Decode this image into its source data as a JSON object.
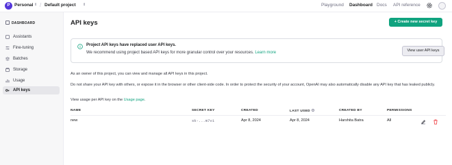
{
  "topbar": {
    "org_initial": "P",
    "org_name": "Personal",
    "project_name": "Default project",
    "nav": [
      "Playground",
      "Dashboard",
      "Docs",
      "API reference"
    ],
    "active_nav": "Dashboard"
  },
  "sidebar": {
    "heading": "DASHBOARD",
    "items": [
      {
        "label": "Assistants",
        "icon": "assistants-icon"
      },
      {
        "label": "Fine-tuning",
        "icon": "fine-tuning-icon"
      },
      {
        "label": "Batches",
        "icon": "batches-icon"
      },
      {
        "label": "Storage",
        "icon": "storage-icon"
      },
      {
        "label": "Usage",
        "icon": "usage-icon"
      },
      {
        "label": "API keys",
        "icon": "key-icon",
        "active": true
      }
    ]
  },
  "main": {
    "title": "API keys",
    "create_button": "+ Create new secret key",
    "notice": {
      "title": "Project API keys have replaced user API keys.",
      "text": "We recommend using project based API keys for more granular control over your resources.",
      "link": "Learn more",
      "button": "View user API keys"
    },
    "para1": "As an owner of this project, you can view and manage all API keys in this project.",
    "para2": "Do not share your API key with others, or expose it in the browser or other client-side code. In order to protect the security of your account, OpenAI may also automatically disable any API key that has leaked publicly.",
    "para3_text": "View usage per API key on the",
    "para3_link": "Usage page",
    "para3_end": "."
  },
  "table": {
    "columns": [
      "NAME",
      "SECRET KEY",
      "CREATED",
      "LAST USED",
      "CREATED BY",
      "PERMISSIONS"
    ],
    "rows": [
      {
        "name": "new",
        "secret_key": "sk-...m7vi",
        "created": "Apr 8, 2024",
        "last_used": "Apr 8, 2024",
        "created_by": "Harshita Batra",
        "permissions": "All"
      }
    ]
  },
  "colors": {
    "accent": "#10a37f",
    "org_avatar": "#5436da",
    "delete": "#ef4146"
  }
}
